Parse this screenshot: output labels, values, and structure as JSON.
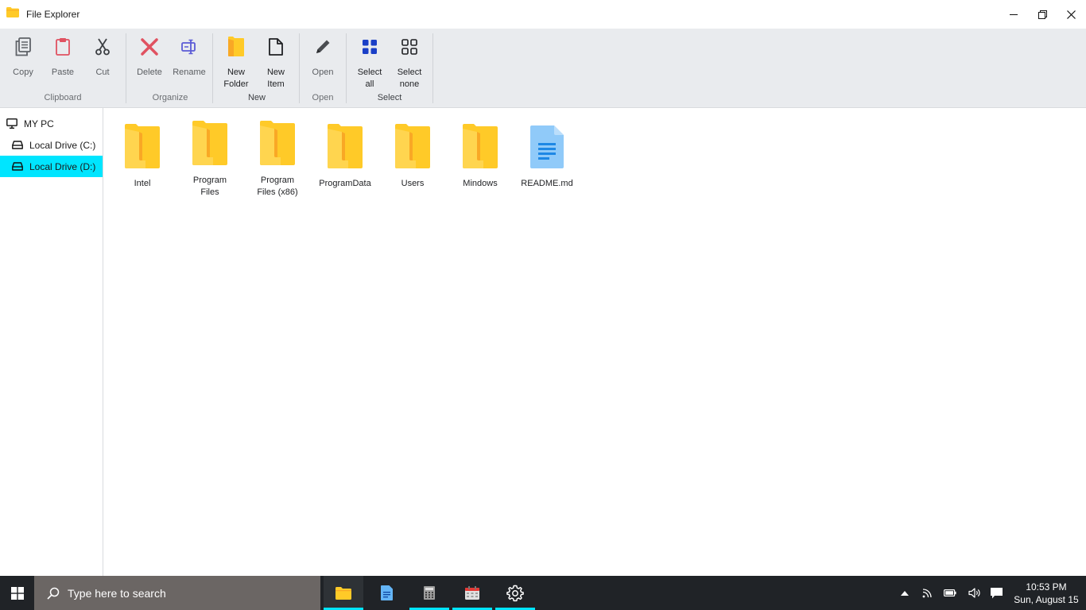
{
  "window": {
    "title": "File Explorer",
    "controls": [
      "minimize",
      "restore",
      "close"
    ]
  },
  "ribbon": {
    "groups": [
      {
        "label": "Clipboard",
        "buttons": [
          {
            "label": "Copy",
            "icon": "copy-icon"
          },
          {
            "label": "Paste",
            "icon": "paste-icon"
          },
          {
            "label": "Cut",
            "icon": "cut-icon"
          }
        ]
      },
      {
        "label": "Organize",
        "buttons": [
          {
            "label": "Delete",
            "icon": "delete-icon"
          },
          {
            "label": "Rename",
            "icon": "rename-icon"
          }
        ]
      },
      {
        "label": "New",
        "buttons": [
          {
            "label": "New\nFolder",
            "icon": "new-folder-icon"
          },
          {
            "label": "New\nItem",
            "icon": "new-item-icon"
          }
        ]
      },
      {
        "label": "Open",
        "buttons": [
          {
            "label": "Open",
            "icon": "pencil-icon"
          }
        ]
      },
      {
        "label": "Select",
        "buttons": [
          {
            "label": "Select\nall",
            "icon": "select-all-icon"
          },
          {
            "label": "Select\nnone",
            "icon": "select-none-icon"
          }
        ]
      }
    ]
  },
  "sidebar": {
    "items": [
      {
        "label": "MY PC",
        "icon": "monitor-icon",
        "selected": false
      },
      {
        "label": "Local Drive (C:)",
        "icon": "drive-icon",
        "selected": false
      },
      {
        "label": "Local Drive (D:)",
        "icon": "drive-icon",
        "selected": true
      }
    ]
  },
  "files": [
    {
      "name": "Intel",
      "type": "folder"
    },
    {
      "name": "Program\nFiles",
      "type": "folder"
    },
    {
      "name": "Program\nFiles (x86)",
      "type": "folder"
    },
    {
      "name": "ProgramData",
      "type": "folder"
    },
    {
      "name": "Users",
      "type": "folder"
    },
    {
      "name": "Mindows",
      "type": "folder"
    },
    {
      "name": "README.md",
      "type": "file"
    }
  ],
  "taskbar": {
    "search_placeholder": "Type here to search",
    "apps": [
      {
        "name": "file-explorer",
        "active": true
      },
      {
        "name": "notepad",
        "active": false
      },
      {
        "name": "calculator",
        "active": false
      },
      {
        "name": "calendar",
        "active": false
      },
      {
        "name": "settings",
        "active": false
      }
    ],
    "clock": {
      "time": "10:53 PM",
      "date": "Sun, August 15"
    }
  },
  "colors": {
    "accent": "#00e5ff",
    "folder": "#ffca28",
    "folder_dark": "#f9a825",
    "doc": "#90caf9",
    "doc_lines": "#1e88e5",
    "delete_red": "#e05261",
    "rename_blue": "#5b5bd6",
    "select_blue": "#1a3fc7",
    "ribbon_bg": "#e9ebee",
    "taskbar_bg": "#202327"
  }
}
